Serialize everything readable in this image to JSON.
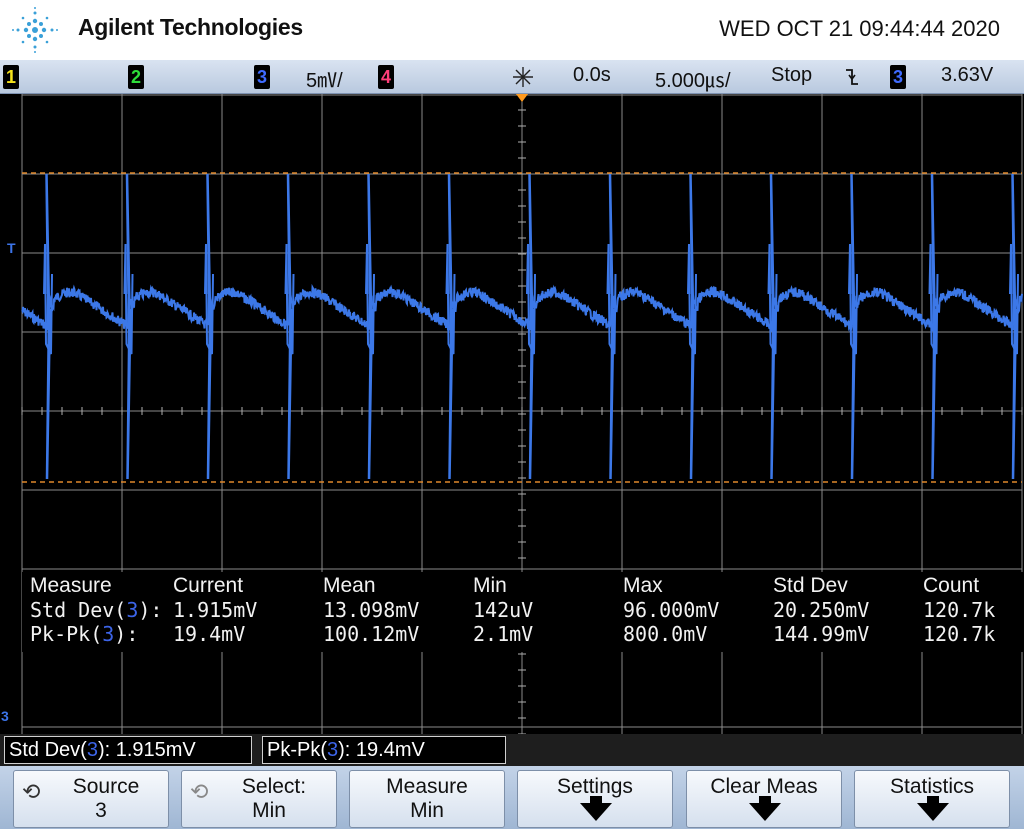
{
  "header": {
    "brand": "Agilent Technologies",
    "datetime": "WED OCT 21 09:44:44 2020",
    "logo_icon": "agilent-spark-logo"
  },
  "status": {
    "channels": [
      {
        "num": "1",
        "color": "#f5e21b"
      },
      {
        "num": "2",
        "color": "#2edc3a"
      },
      {
        "num": "3",
        "color": "#3f6bff"
      },
      {
        "num": "4",
        "color": "#ff3e7a"
      }
    ],
    "ch3_scale": "5㎷/",
    "trigger_icon": "trigger-spark-icon",
    "time_offset": "0.0s",
    "time_scale": "5.000㎲/",
    "run_state": "Stop",
    "trigger_edge_icon": "falling-edge-icon",
    "trigger_channel": "3",
    "trigger_level": "3.63V"
  },
  "screen": {
    "trigger_marker": "T",
    "channel_marker": "3",
    "trace_color": "#3c78e8",
    "cursor_color": "#e0882a"
  },
  "measure": {
    "headers": [
      "Measure",
      "Current",
      "Mean",
      "Min",
      "Max",
      "Std Dev",
      "Count"
    ],
    "rows": [
      {
        "name": "Std Dev(",
        "ch": "3",
        "close": "):",
        "current": "1.915mV",
        "mean": "13.098mV",
        "min": "142uV",
        "max": "96.000mV",
        "std": "20.250mV",
        "count": "120.7k"
      },
      {
        "name": "Pk-Pk(",
        "ch": "3",
        "close": "):",
        "current": "19.4mV",
        "mean": "100.12mV",
        "min": "2.1mV",
        "max": "800.0mV",
        "std": "144.99mV",
        "count": "120.7k"
      }
    ]
  },
  "quick": [
    {
      "name": "Std Dev(",
      "ch": "3",
      "rest": "): 1.915mV"
    },
    {
      "name": "Pk-Pk(",
      "ch": "3",
      "rest": "): 19.4mV"
    }
  ],
  "softkeys": [
    {
      "l1": "Source",
      "l2": "3",
      "icon": "rotary-knob-icon"
    },
    {
      "l1": "Select:",
      "l2": "Min",
      "icon": "rotary-knob-icon"
    },
    {
      "l1": "Measure",
      "l2": "Min"
    },
    {
      "l1": "Settings",
      "l2": ""
    },
    {
      "l1": "Clear Meas",
      "l2": ""
    },
    {
      "l1": "Statistics",
      "l2": ""
    }
  ]
}
